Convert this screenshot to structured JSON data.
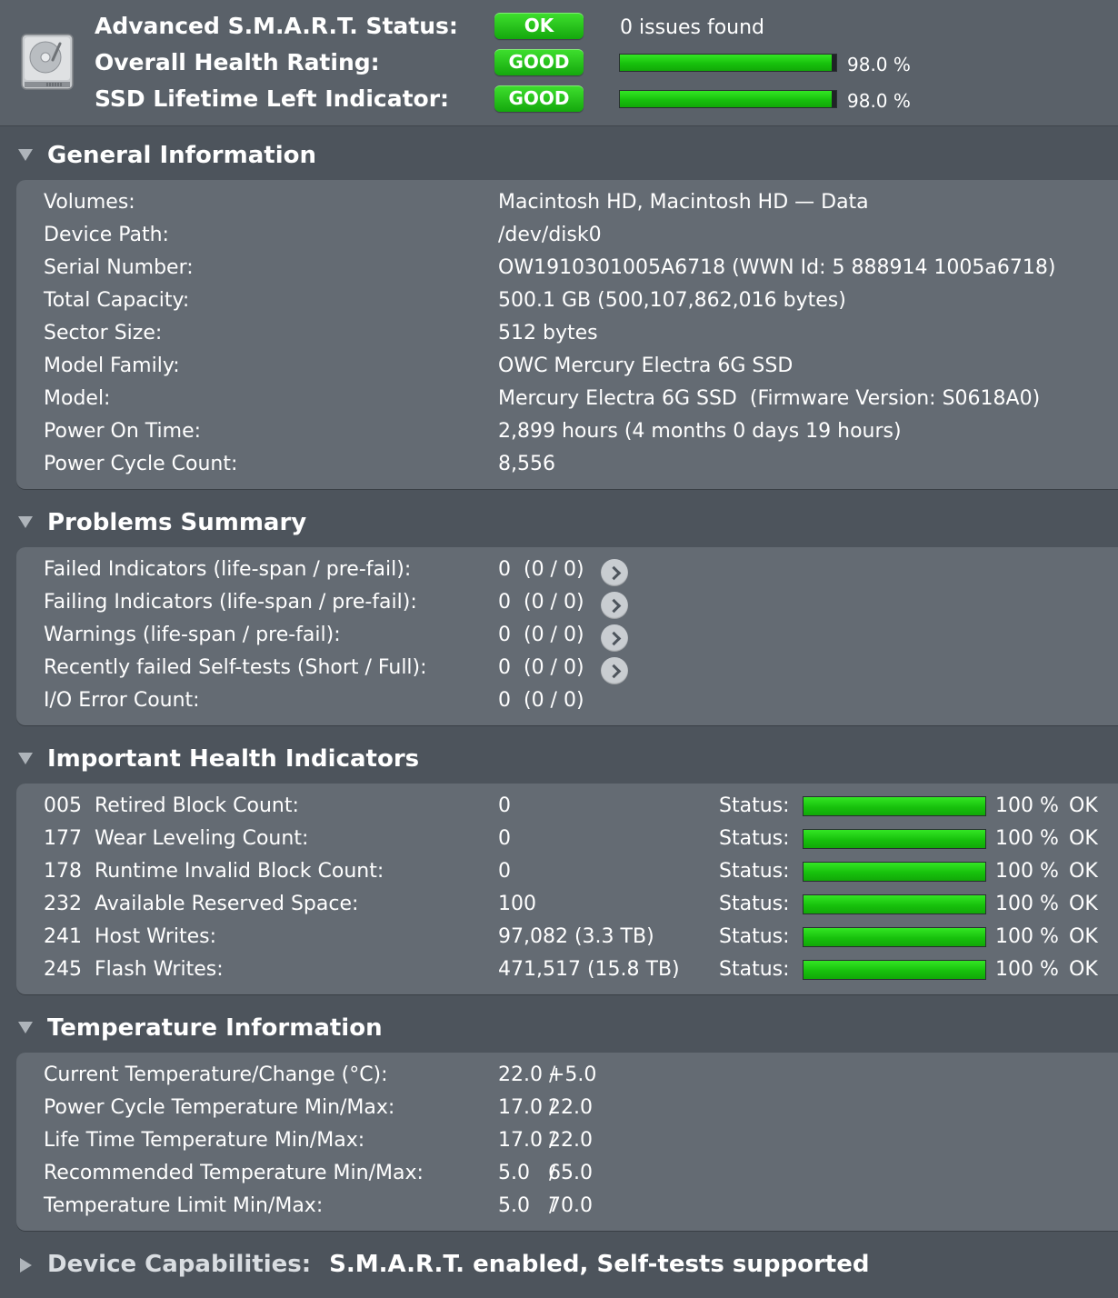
{
  "header": {
    "smart_status": {
      "label": "Advanced S.M.A.R.T. Status:",
      "badge": "OK",
      "note": "0 issues found"
    },
    "health_rating": {
      "label": "Overall Health Rating:",
      "badge": "GOOD",
      "percent_text": "98.0 %",
      "percent": 98.0
    },
    "lifetime_left": {
      "label": "SSD Lifetime Left Indicator:",
      "badge": "GOOD",
      "percent_text": "98.0 %",
      "percent": 98.0
    },
    "icon": "hard-drive-icon"
  },
  "general": {
    "title": "General Information",
    "rows": [
      {
        "label": "Volumes:",
        "value": "Macintosh HD, Macintosh HD — Data"
      },
      {
        "label": "Device Path:",
        "value": "/dev/disk0"
      },
      {
        "label": "Serial Number:",
        "value": "OW1910301005A6718 (WWN Id: 5 888914 1005a6718)"
      },
      {
        "label": "Total Capacity:",
        "value": "500.1 GB (500,107,862,016 bytes)"
      },
      {
        "label": "Sector Size:",
        "value": "512 bytes"
      },
      {
        "label": "Model Family:",
        "value": "OWC Mercury Electra 6G SSD"
      },
      {
        "label": "Model:",
        "value": "Mercury Electra 6G SSD  (Firmware Version: S0618A0)"
      },
      {
        "label": "Power On Time:",
        "value": "2,899 hours (4 months 0 days 19 hours)"
      },
      {
        "label": "Power Cycle Count:",
        "value": "8,556"
      }
    ]
  },
  "problems": {
    "title": "Problems Summary",
    "rows": [
      {
        "label": "Failed Indicators (life-span / pre-fail):",
        "value": "0  (0 / 0)"
      },
      {
        "label": "Failing Indicators (life-span / pre-fail):",
        "value": "0  (0 / 0)"
      },
      {
        "label": "Warnings (life-span / pre-fail):",
        "value": "0  (0 / 0)"
      },
      {
        "label": "Recently failed Self-tests (Short / Full):",
        "value": "0  (0 / 0)"
      },
      {
        "label": "I/O Error Count:",
        "value": "0  (0 / 0)"
      }
    ]
  },
  "health": {
    "title": "Important Health Indicators",
    "status_label": "Status:",
    "rows": [
      {
        "id": "005",
        "name": "Retired Block Count:",
        "value": "0",
        "percent_text": "100 %",
        "percent": 100,
        "status": "OK"
      },
      {
        "id": "177",
        "name": "Wear Leveling Count:",
        "value": "0",
        "percent_text": "100 %",
        "percent": 100,
        "status": "OK"
      },
      {
        "id": "178",
        "name": "Runtime Invalid Block Count:",
        "value": "0",
        "percent_text": "100 %",
        "percent": 100,
        "status": "OK"
      },
      {
        "id": "232",
        "name": "Available Reserved Space:",
        "value": "100",
        "percent_text": "100 %",
        "percent": 100,
        "status": "OK"
      },
      {
        "id": "241",
        "name": "Host Writes:",
        "value": "97,082 (3.3 TB)",
        "percent_text": "100 %",
        "percent": 100,
        "status": "OK"
      },
      {
        "id": "245",
        "name": "Flash Writes:",
        "value": "471,517 (15.8 TB)",
        "percent_text": "100 %",
        "percent": 100,
        "status": "OK"
      }
    ]
  },
  "temperature": {
    "title": "Temperature Information",
    "rows": [
      {
        "label": "Current Temperature/Change (°C):",
        "v1": "22.0 /",
        "v2": "+5.0"
      },
      {
        "label": "Power Cycle Temperature Min/Max:",
        "v1": "17.0 /",
        "v2": "22.0"
      },
      {
        "label": "Life Time Temperature Min/Max:",
        "v1": "17.0 /",
        "v2": "22.0"
      },
      {
        "label": "Recommended Temperature Min/Max:",
        "v1": "5.0   /",
        "v2": "65.0"
      },
      {
        "label": "Temperature Limit Min/Max:",
        "v1": "5.0   /",
        "v2": "70.0"
      }
    ]
  },
  "capabilities": {
    "label": "Device Capabilities:",
    "value": "S.M.A.R.T. enabled, Self-tests supported"
  }
}
